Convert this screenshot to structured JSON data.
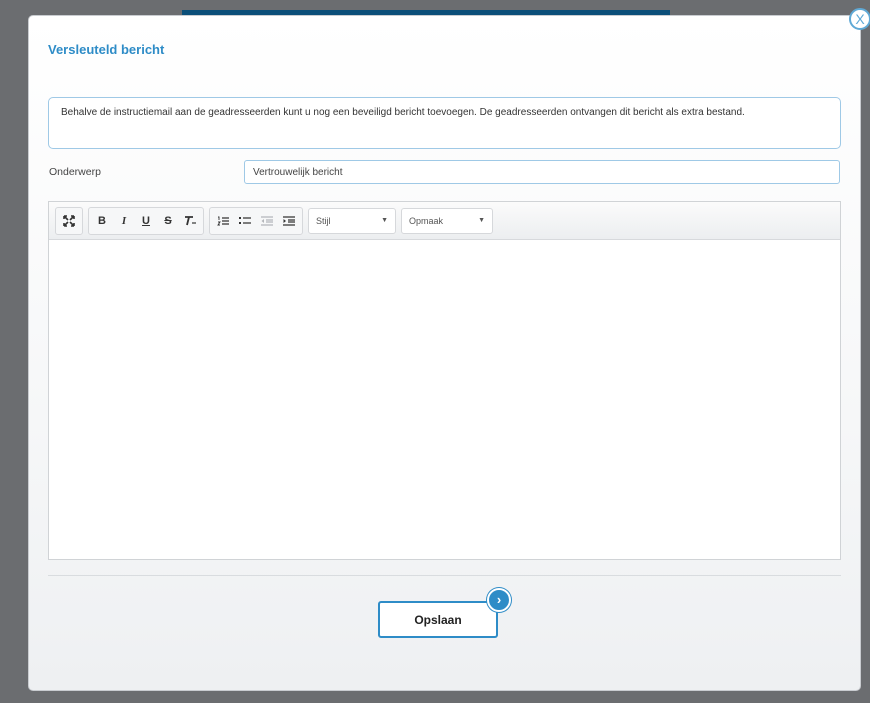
{
  "dialog": {
    "title": "Versleuteld bericht",
    "close_label": "X",
    "info_text": "Behalve de instructiemail aan de geadresseerden kunt u nog een beveiligd bericht toevoegen. De geadresseerden ontvangen dit bericht als extra bestand.",
    "subject": {
      "label": "Onderwerp",
      "value": "Vertrouwelijk bericht"
    },
    "toolbar": {
      "maximize_icon": "expand-icon",
      "bold": "B",
      "italic": "I",
      "underline": "U",
      "strikethrough": "S",
      "clear_format": "Tx",
      "numbered_list_icon": "numbered-list-icon",
      "bulleted_list_icon": "bulleted-list-icon",
      "outdent_icon": "outdent-icon",
      "indent_icon": "indent-icon",
      "style_dropdown": "Stijl",
      "format_dropdown": "Opmaak"
    },
    "editor_content": "",
    "save_label": "Opslaan",
    "colors": {
      "accent": "#2e8cc7",
      "header_strip": "#0b4f79",
      "backdrop": "#6b6d70"
    }
  }
}
